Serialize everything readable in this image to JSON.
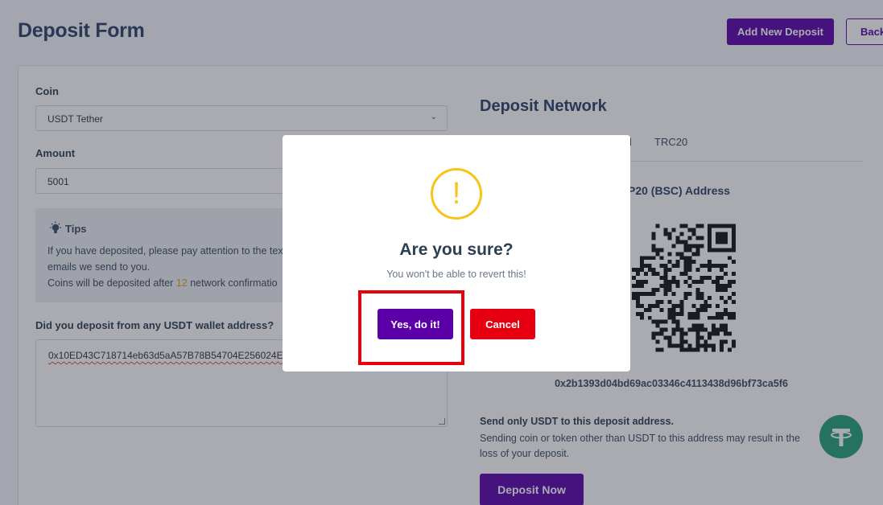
{
  "header": {
    "title": "Deposit Form",
    "add_button": "Add New Deposit",
    "back_button": "Back"
  },
  "form": {
    "coin_label": "Coin",
    "coin_value": "USDT Tether",
    "amount_label": "Amount",
    "amount_value": "5001",
    "tips": {
      "title": "Tips",
      "line1": "If you have deposited, please pay attention to the tex",
      "line2": "emails we send to you.",
      "line3_pre": "Coins will be deposited after ",
      "line3_num": "12",
      "line3_post": " network confirmatio"
    },
    "wallet_label": "Did you deposit from any USDT wallet address?",
    "wallet_value": "0x10ED43C718714eb63d5aA57B78B54704E256024E"
  },
  "network": {
    "title": "Deposit Network",
    "tab_partial": "l",
    "tab_trc20": "TRC20",
    "address_title_partial": "P20 (BSC) Address",
    "address": "0x2b1393d04bd69ac03346c4113438d96bf73ca5f6",
    "warning_title": "Send only USDT to this deposit address.",
    "warning_text": "Sending coin or token other than USDT to this address may result in the loss of your deposit.",
    "deposit_button": "Deposit Now"
  },
  "modal": {
    "icon": "!",
    "title": "Are you sure?",
    "text": "You won't be able to revert this!",
    "confirm": "Yes, do it!",
    "cancel": "Cancel"
  },
  "colors": {
    "primary": "#5b00a8",
    "danger": "#e60012",
    "warning": "#f5c518",
    "tether": "#26a17b"
  }
}
